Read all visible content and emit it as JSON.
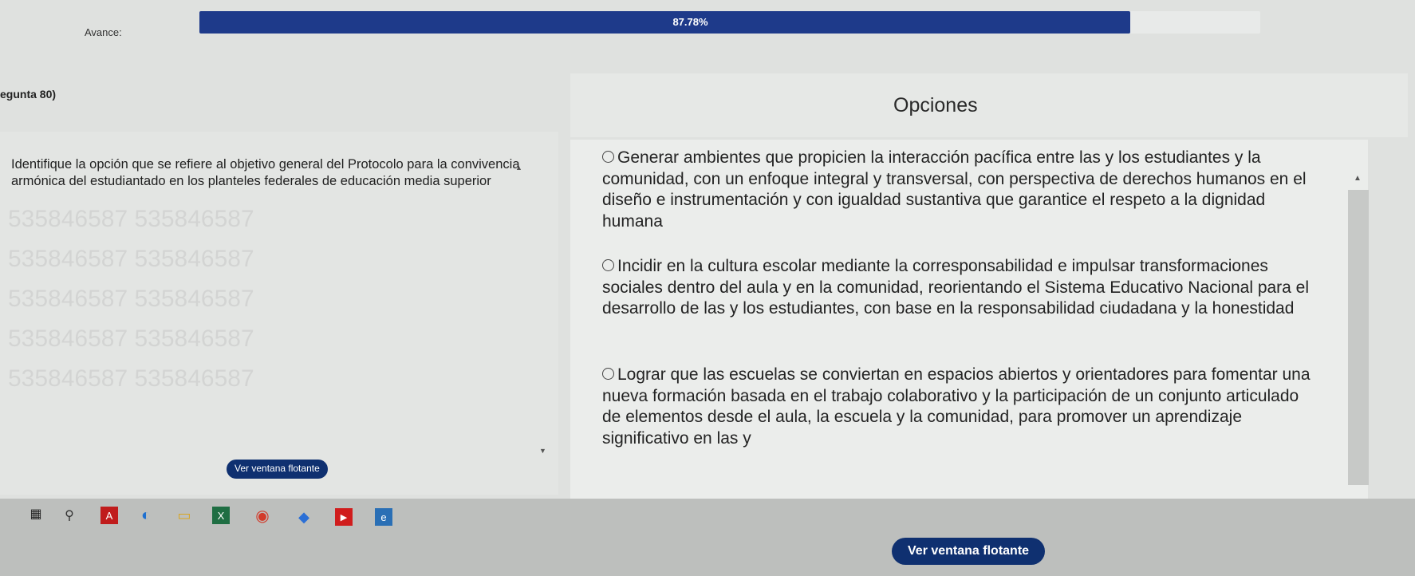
{
  "progress": {
    "label": "Avance:",
    "value_text": "87.78%",
    "value": 87.78,
    "color": "#1e3a8a"
  },
  "question": {
    "label": "egunta 80)",
    "text": "Identifique la opción que se refiere al objetivo general del Protocolo para la convivencia armónica del estudiantado en los planteles federales de educación media superior",
    "watermark": "535846587 535846587"
  },
  "options": {
    "title": "Opciones",
    "items": [
      {
        "text": "Generar ambientes que propicien la interacción pacífica entre las y los estudiantes y la comunidad, con un enfoque integral y transversal, con perspectiva de derechos humanos en el diseño e instrumentación y con igualdad sustantiva que garantice el respeto a la dignidad humana"
      },
      {
        "text": "Incidir en la cultura escolar mediante la corresponsabilidad e impulsar transformaciones sociales dentro del aula y en la comunidad, reorientando el Sistema Educativo Nacional para el desarrollo de las y los estudiantes, con base en la responsabilidad ciudadana y la honestidad"
      },
      {
        "text": "Lograr que las escuelas se conviertan en espacios abiertos y orientadores para fomentar una nueva formación basada en el trabajo colaborativo y la participación de un conjunto articulado de elementos desde el aula, la escuela y la comunidad, para promover un aprendizaje significativo en las y"
      }
    ]
  },
  "floating": {
    "small_label": "Ver ventana flotante",
    "main_label": "Ver ventana flotante"
  },
  "taskbar": {
    "icons": [
      "windows-icon",
      "search-icon",
      "acrobat-icon",
      "edge-icon",
      "file-explorer-icon",
      "excel-icon",
      "chrome-icon",
      "photos-icon",
      "youtube-icon",
      "app-icon"
    ]
  }
}
